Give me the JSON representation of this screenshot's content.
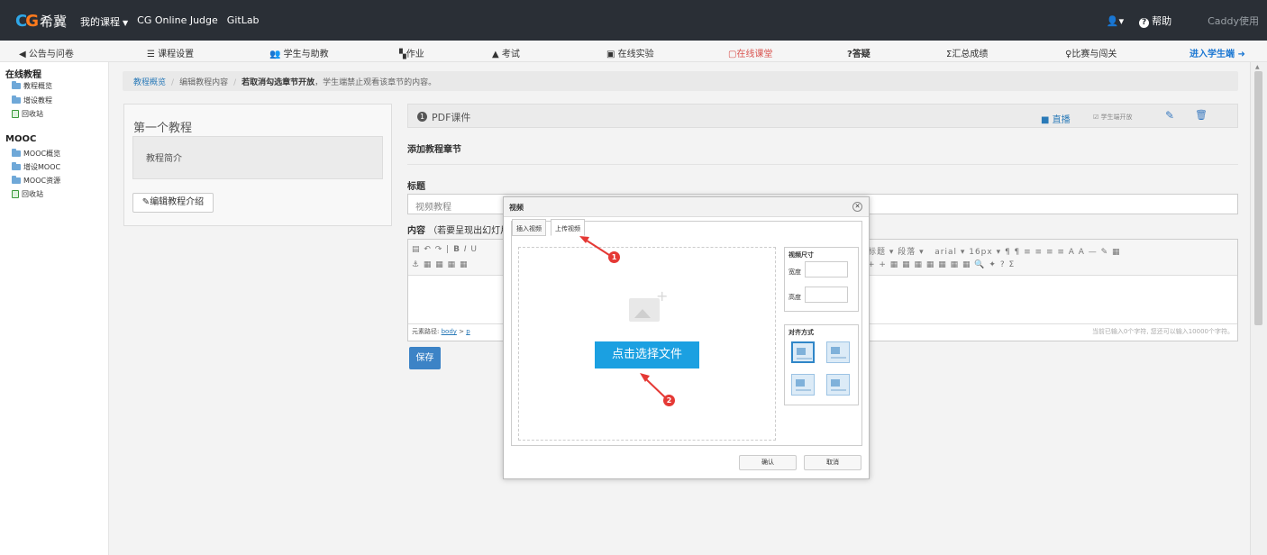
{
  "topbar": {
    "logo_text": "希冀",
    "nav": [
      "我的课程",
      "CG Online Judge",
      "GitLab"
    ],
    "help_label": "帮助",
    "user_name": "Caddy使用"
  },
  "nav2": {
    "items": [
      {
        "label": "公告与问卷",
        "icon": "megaphone-icon"
      },
      {
        "label": "课程设置",
        "icon": "list-icon"
      },
      {
        "label": "学生与助教",
        "icon": "users-icon"
      },
      {
        "label": "作业",
        "icon": "homework-icon"
      },
      {
        "label": "考试",
        "icon": "exam-icon"
      },
      {
        "label": "在线实验",
        "icon": "monitor-icon"
      },
      {
        "label": "在线课堂",
        "icon": "classroom-icon"
      },
      {
        "label": "答疑",
        "icon": "question-icon"
      },
      {
        "label": "汇总成绩",
        "icon": "sigma-icon"
      },
      {
        "label": "比赛与闯关",
        "icon": "trophy-icon"
      },
      {
        "label": "进入学生端",
        "icon": "arrow-right-circle-icon"
      }
    ]
  },
  "sidebar": {
    "section1": "在线教程",
    "items1": [
      "教程概览",
      "增设教程",
      "回收站"
    ],
    "section2": "MOOC",
    "items2": [
      "MOOC概览",
      "增设MOOC",
      "MOOC资源",
      "回收站"
    ]
  },
  "breadcrumb": {
    "item1": "教程概览",
    "item2": "编辑教程内容",
    "notice_bold": "若取消勾选章节开放",
    "notice_rest": "，学生端禁止观看该章节的内容。"
  },
  "left_panel": {
    "title": "第一个教程",
    "intro": "教程简介",
    "edit_button": "编辑教程介绍"
  },
  "chapter_bar": {
    "number": "1",
    "title": "PDF课件",
    "live_label": "直播",
    "open_label": "学生端开放"
  },
  "form": {
    "section_title": "添加教程章节",
    "title_label": "标题",
    "title_value": "视频教程",
    "content_label": "内容",
    "content_hint": "（若要呈现出幻灯片",
    "toolbar_font": "arial",
    "toolbar_size": "16px",
    "toolbar_para": "段落",
    "toolbar_heading": "标题",
    "path_label": "元素路径:",
    "path_body": "body",
    "path_p": "p",
    "char_count": "当前已输入0个字符, 您还可以输入10000个字符。",
    "save_button": "保存"
  },
  "dialog": {
    "title": "视频",
    "tab_insert": "插入视频",
    "tab_upload": "上传视频",
    "choose_button": "点击选择文件",
    "size_title": "视频尺寸",
    "width_label": "宽度",
    "height_label": "高度",
    "align_title": "对齐方式",
    "confirm": "确认",
    "cancel": "取消"
  },
  "annotations": {
    "step1": "1",
    "step2": "2",
    "color": "#e53935"
  }
}
